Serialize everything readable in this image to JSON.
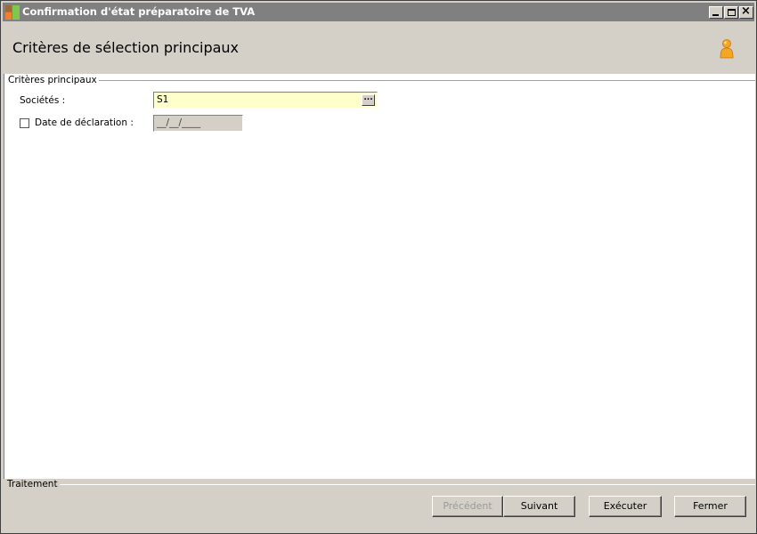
{
  "window": {
    "title": "Confirmation d'état préparatoire de TVA",
    "controls": {
      "minimize": "_",
      "maximize": "□",
      "close": "×"
    }
  },
  "header": {
    "title": "Critères de sélection principaux",
    "user_icon": "person-icon"
  },
  "main_criteria": {
    "group_label": "Critères principaux",
    "societes": {
      "label": "Sociétés :",
      "value": "S1",
      "lookup_button": "..."
    },
    "date_declaration": {
      "label": "Date de déclaration :",
      "checked": false,
      "placeholder": "__/__/____"
    }
  },
  "processing": {
    "group_label": "Traitement",
    "buttons": {
      "previous": "Précédent",
      "next": "Suivant",
      "execute": "Exécuter",
      "close": "Fermer"
    }
  },
  "colors": {
    "titlebar": "#808080",
    "input_highlight": "#ffffcc",
    "window_bg": "#d4d0c8"
  }
}
